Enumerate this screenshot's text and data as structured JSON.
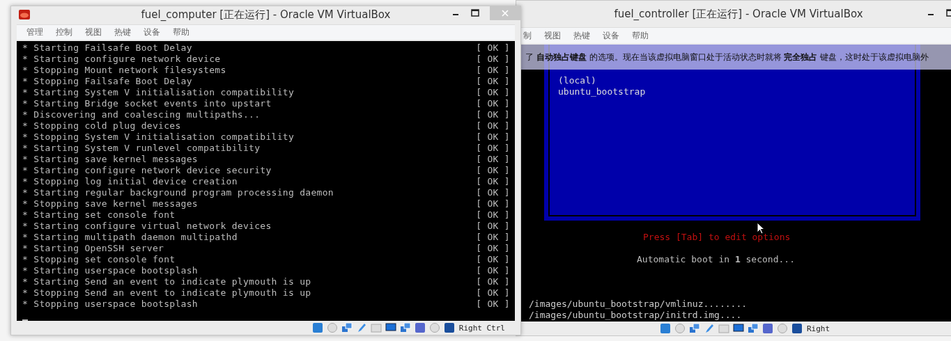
{
  "back_window": {
    "title": "fuel_controller [正在运行] - Oracle VM VirtualBox",
    "menu": [
      "制",
      "视图",
      "热键",
      "设备",
      "帮助"
    ],
    "notice": "了 **自动独占键盘** 的选项。现在当该虚拟电脑窗口处于活动状态时就将 **完全独占** 键盘，这时处于该虚拟电脑外",
    "boot_entries": [
      {
        "label": "(local)",
        "selected": false
      },
      {
        "label": "ubuntu_bootstrap",
        "selected": false
      }
    ],
    "hint": "Press [Tab] to edit options",
    "countdown": "Automatic boot in **1** second...",
    "log": [
      "/images/ubuntu_bootstrap/vmlinuz........",
      "/images/ubuntu_bootstrap/initrd.img...."
    ],
    "host_key": "Right"
  },
  "front_window": {
    "title": "fuel_computer [正在运行] - Oracle VM VirtualBox",
    "menu": [
      "管理",
      "控制",
      "视图",
      "热键",
      "设备",
      "帮助"
    ],
    "lines": [
      {
        "text": "* Starting Failsafe Boot Delay",
        "status": "[ OK ]"
      },
      {
        "text": "* Starting configure network device",
        "status": "[ OK ]"
      },
      {
        "text": "* Stopping Mount network filesystems",
        "status": "[ OK ]"
      },
      {
        "text": "* Stopping Failsafe Boot Delay",
        "status": "[ OK ]"
      },
      {
        "text": "* Starting System V initialisation compatibility",
        "status": "[ OK ]"
      },
      {
        "text": "* Starting Bridge socket events into upstart",
        "status": "[ OK ]"
      },
      {
        "text": "* Discovering and coalescing multipaths...",
        "status": "[ OK ]"
      },
      {
        "text": "* Stopping cold plug devices",
        "status": "[ OK ]"
      },
      {
        "text": "* Stopping System V initialisation compatibility",
        "status": "[ OK ]"
      },
      {
        "text": "* Starting System V runlevel compatibility",
        "status": "[ OK ]"
      },
      {
        "text": "* Starting save kernel messages",
        "status": "[ OK ]"
      },
      {
        "text": "* Starting configure network device security",
        "status": "[ OK ]"
      },
      {
        "text": "* Stopping log initial device creation",
        "status": "[ OK ]"
      },
      {
        "text": "* Starting regular background program processing daemon",
        "status": "[ OK ]"
      },
      {
        "text": "* Stopping save kernel messages",
        "status": "[ OK ]"
      },
      {
        "text": "* Starting set console font",
        "status": "[ OK ]"
      },
      {
        "text": "* Starting configure virtual network devices",
        "status": "[ OK ]"
      },
      {
        "text": "* Starting multipath daemon multipathd",
        "status": "[ OK ]"
      },
      {
        "text": "* Starting OpenSSH server",
        "status": "[ OK ]"
      },
      {
        "text": "* Stopping set console font",
        "status": "[ OK ]"
      },
      {
        "text": "* Starting userspace bootsplash",
        "status": "[ OK ]"
      },
      {
        "text": "* Starting Send an event to indicate plymouth is up",
        "status": "[ OK ]"
      },
      {
        "text": "* Stopping Send an event to indicate plymouth is up",
        "status": "[ OK ]"
      },
      {
        "text": "* Stopping userspace bootsplash",
        "status": "[ OK ]"
      }
    ],
    "host_key": "Right Ctrl"
  }
}
